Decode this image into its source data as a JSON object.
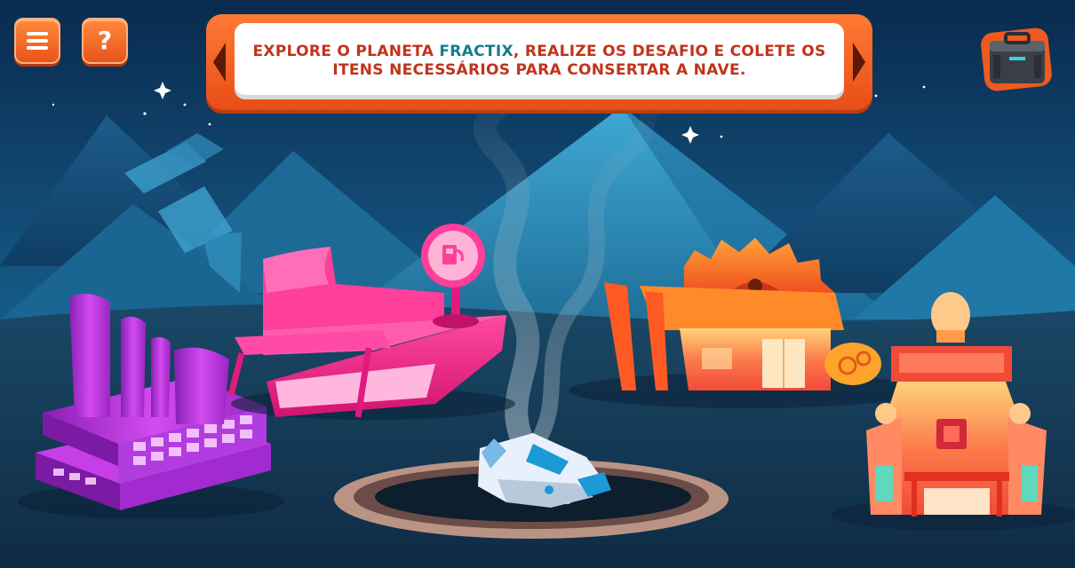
{
  "hud": {
    "menu_icon": "hamburger-icon",
    "help_icon": "question-icon",
    "help_glyph": "?",
    "inventory_icon": "toolbox-icon"
  },
  "banner": {
    "text_before": "EXPLORE O PLANETA ",
    "highlight": "FRACTIX",
    "text_after": ", REALIZE OS DESAFIO E COLETE OS ITENS NECESSÁRIOS PARA CONSERTAR A NAVE.",
    "text_color": "#c0341a",
    "highlight_color": "#137e8e"
  },
  "scene": {
    "buildings": [
      {
        "name": "factory",
        "icon": "factory-icon",
        "color": "#c42bd9"
      },
      {
        "name": "gas-station",
        "icon": "fuel-pump-icon",
        "color": "#ff2d8e"
      },
      {
        "name": "gear-workshop",
        "icon": "gear-icon",
        "color": "#ff6a2a"
      },
      {
        "name": "electronics-lab",
        "icon": "microchip-icon",
        "color": "#f4633f"
      }
    ],
    "ship": {
      "name": "crashed-spaceship",
      "state": "smoking"
    }
  },
  "colors": {
    "sky_dark": "#0b2c52",
    "sky_light": "#2f8fb8",
    "ground": "#163a56",
    "accent_orange": "#ef5a1f"
  }
}
